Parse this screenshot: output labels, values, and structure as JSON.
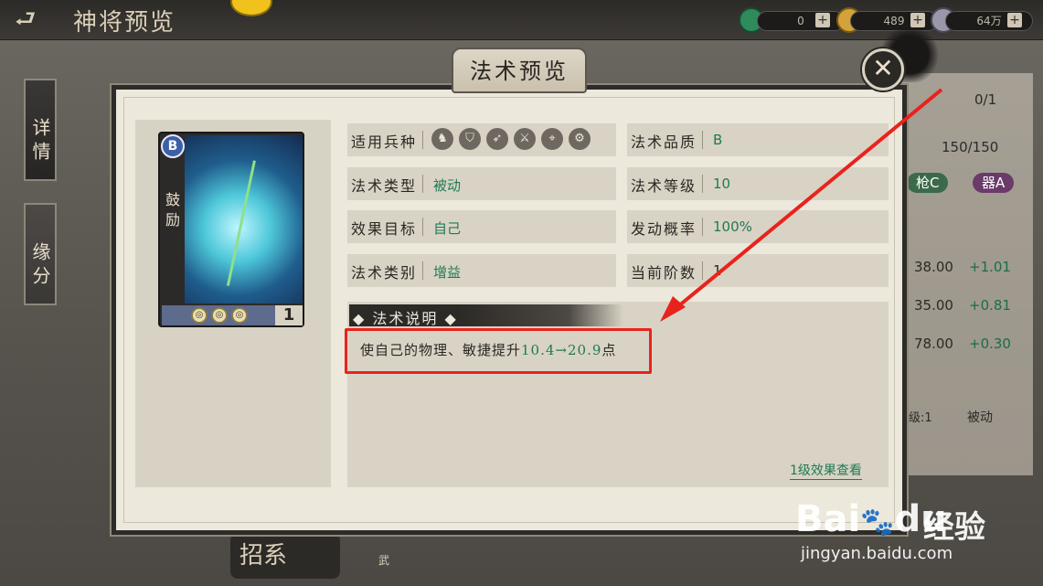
{
  "topbar": {
    "title": "神将预览",
    "back_icon": "back-arrow-icon",
    "resources": [
      {
        "name": "jade",
        "value": "0"
      },
      {
        "name": "copper",
        "value": "489"
      },
      {
        "name": "silver",
        "value": "64万"
      }
    ],
    "plus_label": "+"
  },
  "sidebar": {
    "tabs": [
      {
        "label": "详情",
        "active": true
      },
      {
        "label": "缘分",
        "active": false
      }
    ]
  },
  "background": {
    "progress_1": "0/1",
    "progress_2": "150/150",
    "tag_spear": "枪C",
    "tag_weapon": "器A",
    "stats": [
      {
        "value": "38.00",
        "delta": "+1.01"
      },
      {
        "value": "35.00",
        "delta": "+0.81"
      },
      {
        "value": "78.00",
        "delta": "+0.30"
      }
    ],
    "skill_level_fragment": "级:1",
    "skill_type": "被动",
    "bottom_fragment": "招系",
    "bottom_fragment_2": "武"
  },
  "modal": {
    "title": "法术预览",
    "close_icon": "crossed-swords-close-icon",
    "card": {
      "quality": "B",
      "name": "鼓励",
      "level": "1",
      "orbs": [
        "orb",
        "orb",
        "orb"
      ]
    },
    "info": {
      "troop_label": "适用兵种",
      "troop_icons": [
        "horse-icon",
        "shield-icon",
        "bow-icon",
        "crossed-blades-icon",
        "target-icon",
        "cart-icon"
      ],
      "type_label": "法术类型",
      "type_value": "被动",
      "target_label": "效果目标",
      "target_value": "自己",
      "category_label": "法术类别",
      "category_value": "增益",
      "quality_label": "法术品质",
      "quality_value": "B",
      "level_label": "法术等级",
      "level_value": "10",
      "chance_label": "发动概率",
      "chance_value": "100%",
      "stage_label": "当前阶数",
      "stage_value": "1"
    },
    "description": {
      "header": "法术说明",
      "text_prefix": "使自己的物理、敏捷提升",
      "text_value": "10.4→20.9",
      "text_suffix": "点"
    },
    "level1_link": "1级效果查看"
  },
  "watermark": {
    "logo": "Bai",
    "logo_suffix": "du",
    "cn": "经验",
    "url": "jingyan.baidu.com"
  },
  "colors": {
    "accent_green": "#1e7a55",
    "annotation_red": "#e8231d",
    "panel_bg": "#ece8dc",
    "quality_blue": "#3d5fa6"
  }
}
